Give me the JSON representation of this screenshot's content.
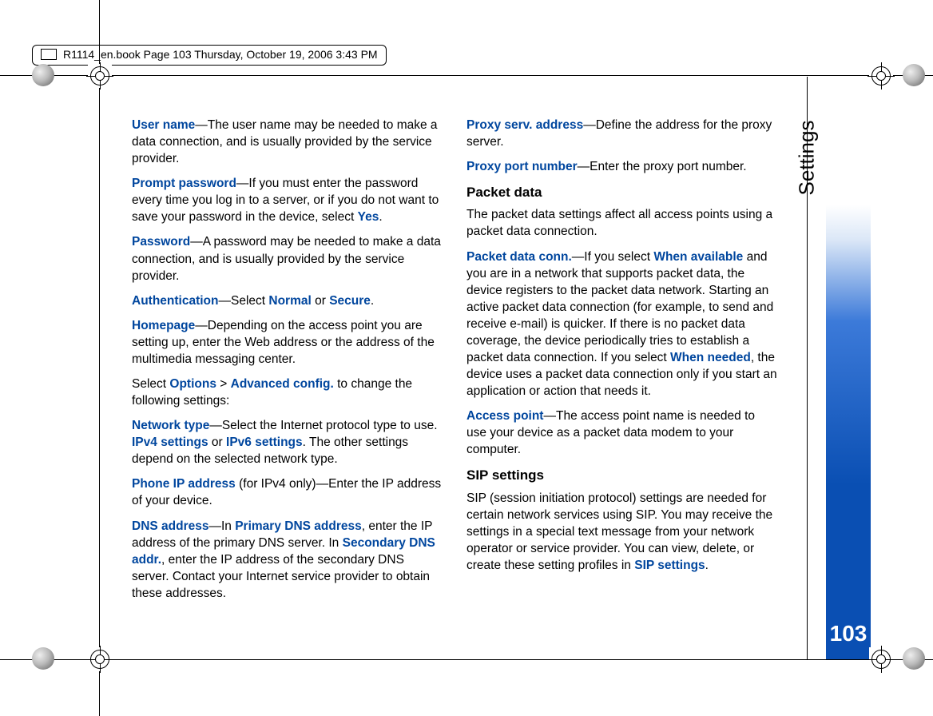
{
  "header": {
    "file_info": "R1114_en.book  Page 103  Thursday, October 19, 2006  3:43 PM"
  },
  "side": {
    "section": "Settings",
    "page": "103"
  },
  "left": {
    "p1_label": "User name",
    "p1_text": "—The user name may be needed to make a data connection, and is usually provided by the service provider.",
    "p2_label": "Prompt password",
    "p2_text_a": "—If you must enter the password every time you log in to a server, or if you do not want to save your password in the device, select ",
    "p2_yes": "Yes",
    "p2_text_b": ".",
    "p3_label": "Password",
    "p3_text": "—A password may be needed to make a data connection, and is usually provided by the service provider.",
    "p4_label": "Authentication",
    "p4_text_a": "—Select ",
    "p4_normal": "Normal",
    "p4_or": " or ",
    "p4_secure": "Secure",
    "p4_text_b": ".",
    "p5_label": "Homepage",
    "p5_text": "—Depending on the access point you are setting up, enter the Web address or the address of the multimedia messaging center.",
    "p6_a": "Select ",
    "p6_options": "Options",
    "p6_gt": " > ",
    "p6_adv": "Advanced config.",
    "p6_b": " to change the following settings:",
    "p7_label": "Network type",
    "p7_text_a": "—Select the Internet protocol type to use. ",
    "p7_ipv4": "IPv4 settings",
    "p7_or": " or ",
    "p7_ipv6": "IPv6 settings",
    "p7_text_b": ". The other settings depend on the selected network type.",
    "p8_label": "Phone IP address",
    "p8_text": " (for IPv4 only)—Enter the IP address of your device.",
    "p9_label": "DNS address",
    "p9_text_a": "—In ",
    "p9_primary": "Primary DNS address",
    "p9_text_b": ", enter the IP address of the primary DNS server. In ",
    "p9_secondary": "Secondary DNS addr.",
    "p9_text_c": ", enter the IP address of the secondary DNS server. Contact your Internet service provider to obtain these addresses."
  },
  "right": {
    "p1_label": "Proxy serv. address",
    "p1_text": "—Define the address for the proxy server.",
    "p2_label": "Proxy port number",
    "p2_text": "—Enter the proxy port number.",
    "h1": "Packet data",
    "p3_text": "The packet data settings affect all access points using a packet data connection.",
    "p4_label": "Packet data conn.",
    "p4_text_a": "—If you select ",
    "p4_when_avail": "When available",
    "p4_text_b": " and you are in a network that supports packet data, the device registers to the packet data network. Starting an active packet data connection (for example, to send and receive e-mail) is quicker. If there is no packet data coverage, the device periodically tries to establish a packet data connection. If you select ",
    "p4_when_needed": "When needed",
    "p4_text_c": ", the device uses a packet data connection only if you start an application or action that needs it.",
    "p5_label": "Access point",
    "p5_text": "—The access point name is needed to use your device as a packet data modem to your computer.",
    "h2": "SIP settings",
    "p6_text_a": "SIP (session initiation protocol) settings are needed for certain network services using SIP. You may receive the settings in a special text message from your network operator or service provider. You can view, delete, or create these setting profiles in ",
    "p6_sip": "SIP settings",
    "p6_text_b": "."
  }
}
